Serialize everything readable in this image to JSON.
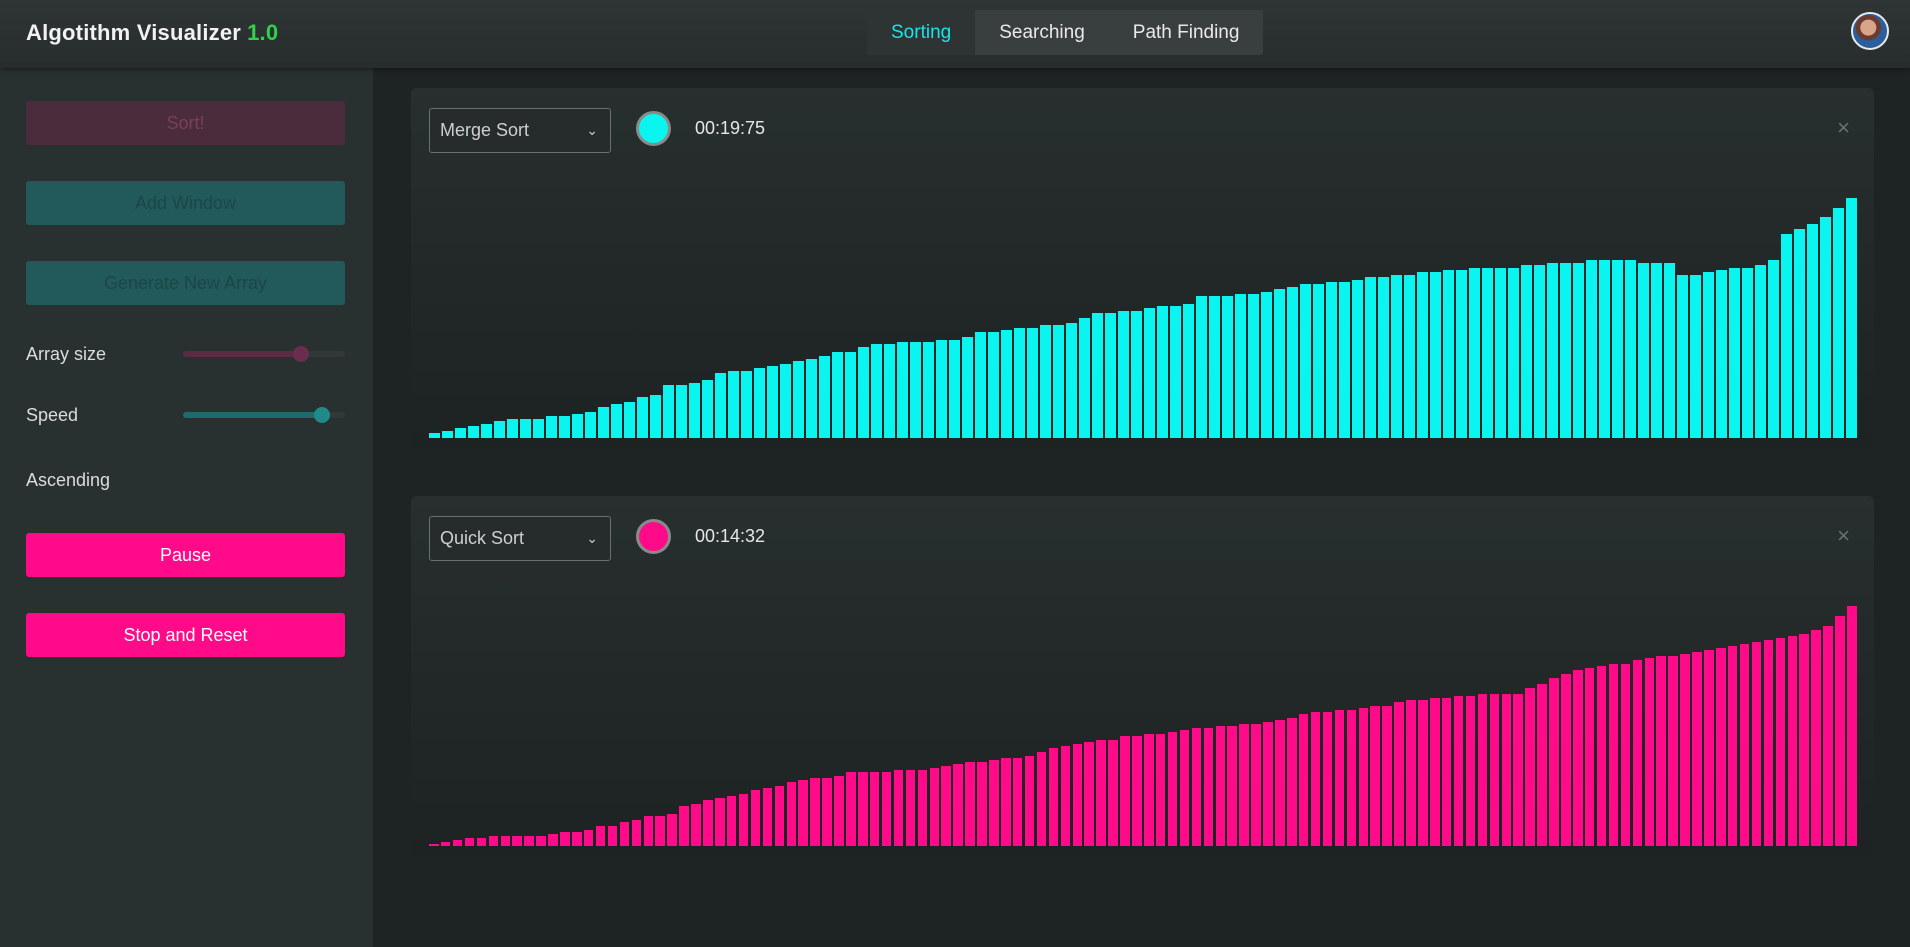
{
  "app": {
    "title": "Algotithm Visualizer",
    "version": "1.0"
  },
  "nav": {
    "tabs": [
      "Sorting",
      "Searching",
      "Path Finding"
    ],
    "active": "Sorting"
  },
  "sidebar": {
    "sort_label": "Sort!",
    "add_window_label": "Add Window",
    "generate_label": "Generate New Array",
    "array_size_label": "Array size",
    "array_size_value": 0.73,
    "speed_label": "Speed",
    "speed_value": 0.86,
    "ascending_label": "Ascending",
    "ascending_on": true,
    "pause_label": "Pause",
    "stop_label": "Stop and Reset"
  },
  "windows": [
    {
      "algorithm": "Merge Sort",
      "timer": "00:19:75",
      "color": "#0af5f0",
      "chart_data": {
        "type": "bar",
        "values": [
          2,
          3,
          4,
          5,
          6,
          7,
          8,
          8,
          8,
          9,
          9,
          10,
          11,
          13,
          14,
          15,
          17,
          18,
          22,
          22,
          23,
          24,
          27,
          28,
          28,
          29,
          30,
          31,
          32,
          33,
          34,
          36,
          36,
          38,
          39,
          39,
          40,
          40,
          40,
          41,
          41,
          42,
          44,
          44,
          45,
          46,
          46,
          47,
          47,
          48,
          50,
          52,
          52,
          53,
          53,
          54,
          55,
          55,
          56,
          59,
          59,
          59,
          60,
          60,
          61,
          62,
          63,
          64,
          64,
          65,
          65,
          66,
          67,
          67,
          68,
          68,
          69,
          69,
          70,
          70,
          71,
          71,
          71,
          71,
          72,
          72,
          73,
          73,
          73,
          74,
          74,
          74,
          74,
          73,
          73,
          73,
          68,
          68,
          69,
          70,
          71,
          71,
          72,
          74,
          85,
          87,
          89,
          92,
          96,
          100
        ]
      }
    },
    {
      "algorithm": "Quick Sort",
      "timer": "00:14:32",
      "color": "#ff0a88",
      "chart_data": {
        "type": "bar",
        "values": [
          1,
          2,
          3,
          4,
          4,
          5,
          5,
          5,
          5,
          5,
          6,
          7,
          7,
          8,
          10,
          10,
          12,
          13,
          15,
          15,
          16,
          20,
          21,
          23,
          24,
          25,
          26,
          28,
          29,
          30,
          32,
          33,
          34,
          34,
          35,
          37,
          37,
          37,
          37,
          38,
          38,
          38,
          39,
          40,
          41,
          42,
          42,
          43,
          44,
          44,
          45,
          47,
          49,
          50,
          51,
          52,
          53,
          53,
          55,
          55,
          56,
          56,
          57,
          58,
          59,
          59,
          60,
          60,
          61,
          61,
          62,
          63,
          64,
          66,
          67,
          67,
          68,
          68,
          69,
          70,
          70,
          72,
          73,
          73,
          74,
          74,
          75,
          75,
          76,
          76,
          76,
          76,
          79,
          81,
          84,
          86,
          88,
          89,
          90,
          91,
          91,
          93,
          94,
          95,
          95,
          96,
          97,
          98,
          99,
          100,
          101,
          102,
          103,
          104,
          105,
          106,
          108,
          110,
          115,
          120
        ]
      }
    }
  ]
}
